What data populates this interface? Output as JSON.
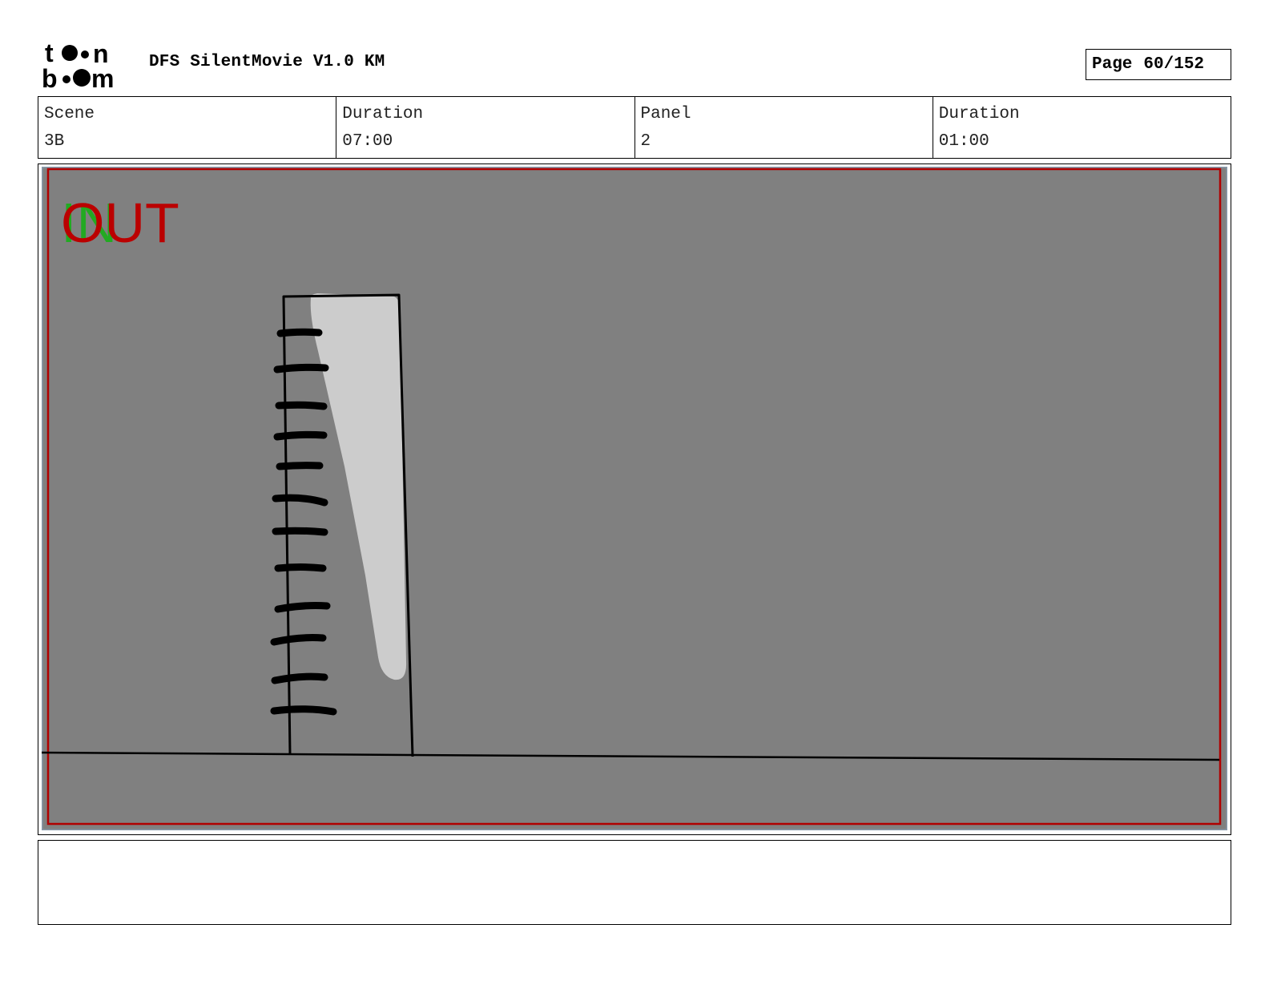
{
  "header": {
    "logo_text": "toonboom",
    "title": "DFS SilentMovie V1.0 KM",
    "page_label": "Page",
    "page_number": "60/152"
  },
  "info": {
    "scene_label": "Scene",
    "scene_value": "3B",
    "scene_duration_label": "Duration",
    "scene_duration_value": "07:00",
    "panel_label": "Panel",
    "panel_value": "2",
    "panel_duration_label": "Duration",
    "panel_duration_value": "01:00"
  },
  "panel": {
    "in_marker": "IN",
    "out_marker": "OUT",
    "colors": {
      "background": "#808080",
      "border": "#8899aa",
      "safe_frame": "#b00000",
      "in_marker": "#22aa22",
      "out_marker": "#bb0000",
      "light_shape": "#cccccc",
      "ink": "#000000"
    }
  },
  "notes": {
    "text": ""
  }
}
